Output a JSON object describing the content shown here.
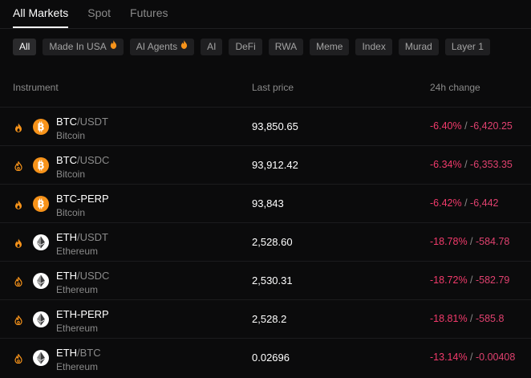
{
  "tabs": [
    {
      "label": "All Markets",
      "active": true
    },
    {
      "label": "Spot",
      "active": false
    },
    {
      "label": "Futures",
      "active": false
    }
  ],
  "chips": [
    {
      "label": "All",
      "active": true,
      "hot": false
    },
    {
      "label": "Made In USA",
      "active": false,
      "hot": true
    },
    {
      "label": "AI Agents",
      "active": false,
      "hot": true
    },
    {
      "label": "AI",
      "active": false,
      "hot": false
    },
    {
      "label": "DeFi",
      "active": false,
      "hot": false
    },
    {
      "label": "RWA",
      "active": false,
      "hot": false
    },
    {
      "label": "Meme",
      "active": false,
      "hot": false
    },
    {
      "label": "Index",
      "active": false,
      "hot": false
    },
    {
      "label": "Murad",
      "active": false,
      "hot": false
    },
    {
      "label": "Layer 1",
      "active": false,
      "hot": false
    }
  ],
  "table": {
    "headers": {
      "instrument": "Instrument",
      "last_price": "Last price",
      "change": "24h change"
    },
    "rows": [
      {
        "fav": "filled",
        "coin": "btc",
        "base": "BTC",
        "quote": "/USDT",
        "name": "Bitcoin",
        "price": "93,850.65",
        "pct": "-6.40%",
        "sep": " / ",
        "abs": "-6,420.25"
      },
      {
        "fav": "outline",
        "coin": "btc",
        "base": "BTC",
        "quote": "/USDC",
        "name": "Bitcoin",
        "price": "93,912.42",
        "pct": "-6.34%",
        "sep": " / ",
        "abs": "-6,353.35"
      },
      {
        "fav": "filled",
        "coin": "btc",
        "base": "BTC-PERP",
        "quote": "",
        "name": "Bitcoin",
        "price": "93,843",
        "pct": "-6.42%",
        "sep": " / ",
        "abs": "-6,442"
      },
      {
        "fav": "filled",
        "coin": "eth",
        "base": "ETH",
        "quote": "/USDT",
        "name": "Ethereum",
        "price": "2,528.60",
        "pct": "-18.78%",
        "sep": " / ",
        "abs": "-584.78"
      },
      {
        "fav": "outline",
        "coin": "eth",
        "base": "ETH",
        "quote": "/USDC",
        "name": "Ethereum",
        "price": "2,530.31",
        "pct": "-18.72%",
        "sep": " / ",
        "abs": "-582.79"
      },
      {
        "fav": "outline",
        "coin": "eth",
        "base": "ETH-PERP",
        "quote": "",
        "name": "Ethereum",
        "price": "2,528.2",
        "pct": "-18.81%",
        "sep": " / ",
        "abs": "-585.8"
      },
      {
        "fav": "outline",
        "coin": "eth",
        "base": "ETH",
        "quote": "/BTC",
        "name": "Ethereum",
        "price": "0.02696",
        "pct": "-13.14%",
        "sep": " / ",
        "abs": "-0.00408"
      }
    ]
  },
  "colors": {
    "accent_hot": "#f7931a",
    "negative": "#f23a6b",
    "btc": "#f7931a"
  }
}
